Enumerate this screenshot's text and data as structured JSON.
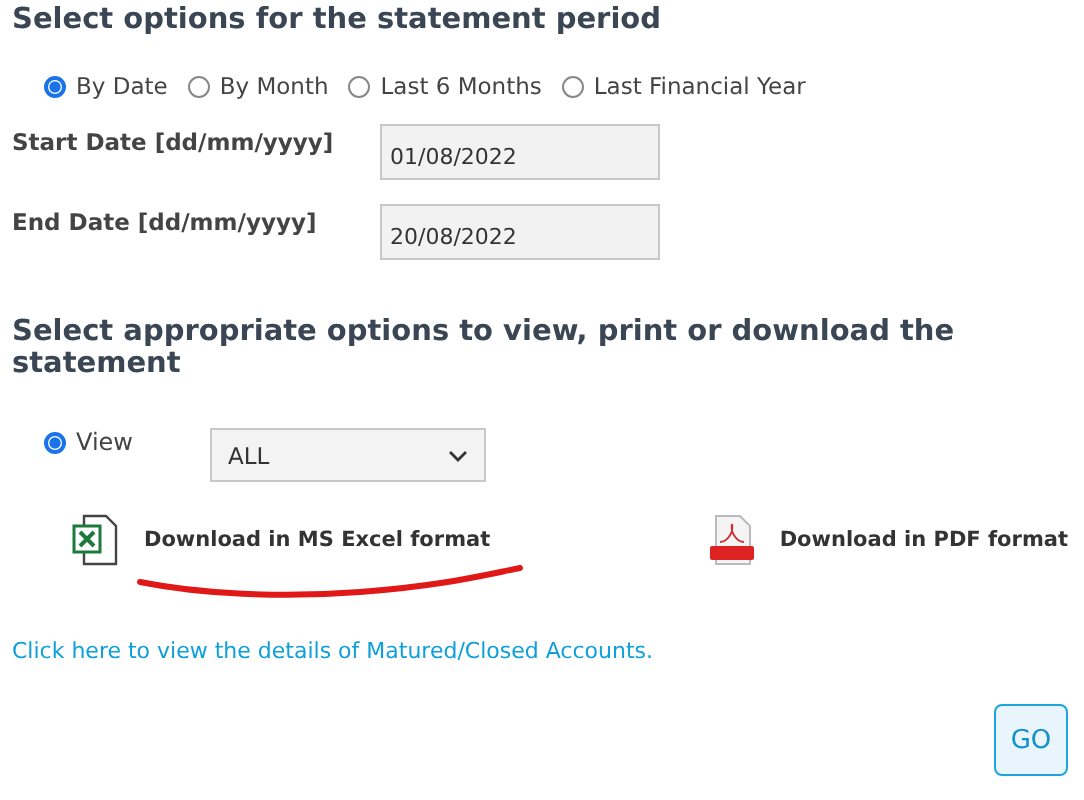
{
  "period": {
    "heading": "Select options for the statement period",
    "options": [
      {
        "label": "By Date",
        "selected": true
      },
      {
        "label": "By Month",
        "selected": false
      },
      {
        "label": "Last 6 Months",
        "selected": false
      },
      {
        "label": "Last Financial Year",
        "selected": false
      }
    ],
    "fields": [
      {
        "label": "Start Date [dd/mm/yyyy]",
        "value": "01/08/2022"
      },
      {
        "label": "End Date [dd/mm/yyyy]",
        "value": "20/08/2022"
      }
    ]
  },
  "output": {
    "heading": "Select appropriate options to view, print or download the statement",
    "view": {
      "label": "View",
      "selected": true,
      "value": "ALL"
    },
    "downloads": [
      {
        "kind": "excel",
        "label": "Download in MS Excel format"
      },
      {
        "kind": "pdf",
        "label": "Download in PDF format"
      }
    ]
  },
  "link": "Click here to view the details of Matured/Closed Accounts.",
  "go_button": "GO"
}
